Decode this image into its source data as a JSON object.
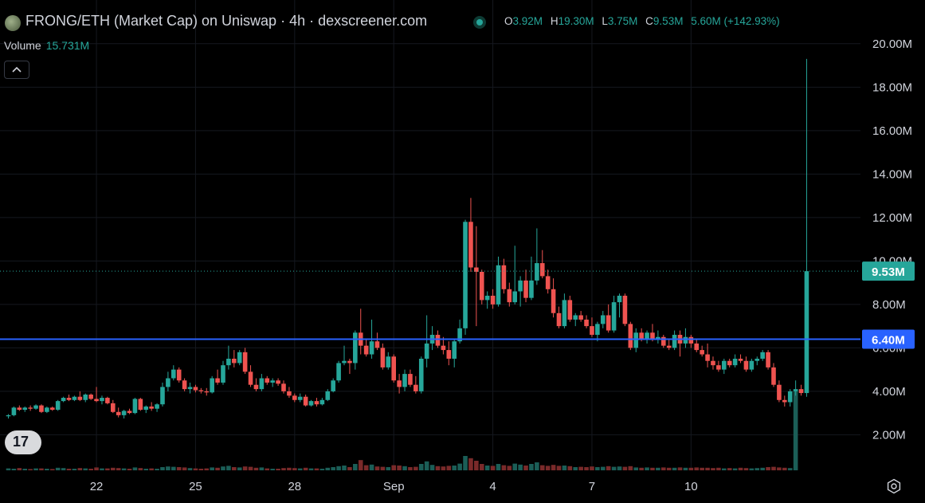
{
  "header": {
    "title": "FRONG/ETH (Market Cap) on Uniswap · 4h · dexscreener.com",
    "ohlc": [
      {
        "key": "O",
        "value": "3.92M"
      },
      {
        "key": "H",
        "value": "19.30M"
      },
      {
        "key": "L",
        "value": "3.75M"
      },
      {
        "key": "C",
        "value": "9.53M"
      },
      {
        "key": "",
        "value": "5.60M (+142.93%)"
      }
    ]
  },
  "volume_legend": {
    "label": "Volume",
    "value": "15.731M"
  },
  "colors": {
    "up": "#26a69a",
    "down": "#ef5350",
    "hline": "#2962ff",
    "background": "#000000",
    "text": "#d1d4dc"
  },
  "icons": {
    "collapse": "chevron-up-icon",
    "logo": "tradingview-logo-icon",
    "settings": "gear-icon"
  },
  "tv_logo_text": "17",
  "chart_data": {
    "type": "candlestick",
    "y_unit": "M",
    "ylim": [
      0.4,
      20.8
    ],
    "y_ticks": [
      "2.00M",
      "4.00M",
      "6.00M",
      "8.00M",
      "10.00M",
      "12.00M",
      "14.00M",
      "16.00M",
      "18.00M",
      "20.00M"
    ],
    "x_ticks": [
      "22",
      "25",
      "28",
      "Sep",
      "4",
      "7",
      "10"
    ],
    "grid": true,
    "last_price_label": "9.53M",
    "last_price": 9.53,
    "horizontal_line": {
      "value": 6.4,
      "label": "6.40M"
    },
    "ohlc": [
      [
        2.85,
        2.95,
        2.75,
        2.9
      ],
      [
        2.9,
        3.3,
        2.85,
        3.25
      ],
      [
        3.25,
        3.35,
        3.1,
        3.15
      ],
      [
        3.15,
        3.3,
        3.05,
        3.25
      ],
      [
        3.25,
        3.35,
        3.1,
        3.2
      ],
      [
        3.2,
        3.4,
        3.15,
        3.35
      ],
      [
        3.35,
        3.4,
        3.0,
        3.05
      ],
      [
        3.05,
        3.3,
        3.0,
        3.25
      ],
      [
        3.25,
        3.3,
        3.1,
        3.15
      ],
      [
        3.15,
        3.6,
        3.1,
        3.55
      ],
      [
        3.55,
        3.75,
        3.5,
        3.7
      ],
      [
        3.7,
        3.85,
        3.55,
        3.6
      ],
      [
        3.6,
        3.8,
        3.55,
        3.75
      ],
      [
        3.75,
        4.0,
        3.55,
        3.6
      ],
      [
        3.6,
        3.9,
        3.5,
        3.85
      ],
      [
        3.85,
        3.9,
        3.6,
        3.65
      ],
      [
        3.65,
        4.2,
        3.5,
        3.55
      ],
      [
        3.55,
        3.8,
        3.4,
        3.7
      ],
      [
        3.7,
        3.75,
        3.4,
        3.45
      ],
      [
        3.45,
        3.6,
        3.0,
        3.05
      ],
      [
        3.05,
        3.25,
        2.8,
        2.9
      ],
      [
        2.9,
        3.15,
        2.75,
        3.1
      ],
      [
        3.1,
        3.2,
        2.95,
        3.0
      ],
      [
        3.0,
        3.7,
        2.95,
        3.65
      ],
      [
        3.65,
        3.7,
        3.1,
        3.15
      ],
      [
        3.15,
        3.35,
        3.0,
        3.3
      ],
      [
        3.3,
        3.5,
        3.1,
        3.2
      ],
      [
        3.2,
        3.45,
        3.05,
        3.4
      ],
      [
        3.4,
        4.4,
        3.3,
        4.2
      ],
      [
        4.2,
        4.9,
        4.0,
        4.6
      ],
      [
        4.6,
        5.2,
        4.5,
        5.0
      ],
      [
        5.0,
        5.1,
        4.4,
        4.5
      ],
      [
        4.5,
        4.6,
        4.0,
        4.1
      ],
      [
        4.1,
        4.4,
        3.9,
        4.2
      ],
      [
        4.2,
        4.3,
        3.95,
        4.05
      ],
      [
        4.05,
        4.15,
        3.9,
        4.0
      ],
      [
        4.0,
        4.15,
        3.8,
        3.95
      ],
      [
        3.95,
        4.7,
        3.9,
        4.6
      ],
      [
        4.6,
        5.0,
        4.3,
        4.4
      ],
      [
        4.4,
        5.4,
        4.3,
        5.2
      ],
      [
        5.2,
        6.1,
        5.0,
        5.5
      ],
      [
        5.5,
        5.9,
        5.1,
        5.3
      ],
      [
        5.3,
        5.9,
        5.2,
        5.8
      ],
      [
        5.8,
        6.0,
        4.8,
        4.9
      ],
      [
        4.9,
        5.2,
        4.2,
        4.3
      ],
      [
        4.3,
        4.6,
        4.0,
        4.1
      ],
      [
        4.1,
        4.8,
        4.0,
        4.6
      ],
      [
        4.6,
        4.7,
        4.3,
        4.4
      ],
      [
        4.4,
        4.6,
        4.2,
        4.5
      ],
      [
        4.5,
        4.6,
        4.25,
        4.35
      ],
      [
        4.35,
        4.5,
        3.9,
        4.0
      ],
      [
        4.0,
        4.2,
        3.7,
        3.8
      ],
      [
        3.8,
        3.9,
        3.5,
        3.6
      ],
      [
        3.6,
        3.9,
        3.5,
        3.75
      ],
      [
        3.75,
        3.85,
        3.3,
        3.35
      ],
      [
        3.35,
        3.6,
        3.3,
        3.55
      ],
      [
        3.55,
        3.7,
        3.3,
        3.4
      ],
      [
        3.4,
        3.7,
        3.35,
        3.6
      ],
      [
        3.6,
        4.1,
        3.55,
        4.0
      ],
      [
        4.0,
        4.6,
        3.95,
        4.5
      ],
      [
        4.5,
        5.4,
        4.4,
        5.3
      ],
      [
        5.3,
        6.1,
        5.2,
        5.4
      ],
      [
        5.4,
        5.5,
        4.8,
        5.3
      ],
      [
        5.3,
        6.8,
        5.0,
        6.7
      ],
      [
        6.7,
        7.8,
        5.7,
        6.1
      ],
      [
        6.1,
        6.4,
        5.6,
        5.7
      ],
      [
        5.7,
        7.3,
        5.5,
        6.3
      ],
      [
        6.3,
        6.7,
        5.9,
        6.0
      ],
      [
        6.0,
        6.2,
        5.0,
        5.1
      ],
      [
        5.1,
        5.8,
        5.0,
        5.6
      ],
      [
        5.6,
        5.7,
        4.4,
        4.5
      ],
      [
        4.5,
        4.8,
        3.9,
        4.2
      ],
      [
        4.2,
        5.0,
        4.0,
        4.8
      ],
      [
        4.8,
        5.0,
        4.2,
        4.3
      ],
      [
        4.3,
        4.7,
        3.9,
        4.0
      ],
      [
        4.0,
        5.6,
        3.9,
        5.5
      ],
      [
        5.5,
        7.5,
        5.1,
        6.2
      ],
      [
        6.2,
        7.0,
        5.9,
        6.6
      ],
      [
        6.6,
        6.8,
        6.0,
        6.1
      ],
      [
        6.1,
        6.5,
        5.7,
        5.9
      ],
      [
        5.9,
        6.3,
        5.2,
        5.5
      ],
      [
        5.5,
        6.4,
        5.1,
        6.3
      ],
      [
        6.3,
        7.3,
        6.2,
        6.9
      ],
      [
        6.9,
        11.9,
        6.6,
        11.8
      ],
      [
        11.8,
        12.9,
        9.5,
        9.7
      ],
      [
        9.7,
        11.6,
        7.0,
        9.5
      ],
      [
        9.5,
        9.6,
        8.0,
        8.2
      ],
      [
        8.2,
        8.6,
        7.8,
        8.4
      ],
      [
        8.4,
        8.7,
        7.8,
        8.0
      ],
      [
        8.0,
        10.2,
        7.9,
        9.8
      ],
      [
        9.8,
        10.1,
        8.5,
        8.7
      ],
      [
        8.7,
        9.0,
        7.9,
        8.1
      ],
      [
        8.1,
        10.7,
        8.0,
        8.6
      ],
      [
        8.6,
        9.3,
        7.9,
        9.1
      ],
      [
        9.1,
        9.6,
        8.1,
        8.3
      ],
      [
        8.3,
        10.2,
        8.2,
        9.1
      ],
      [
        9.1,
        11.5,
        8.9,
        9.9
      ],
      [
        9.9,
        10.5,
        9.2,
        9.3
      ],
      [
        9.3,
        9.6,
        8.5,
        8.7
      ],
      [
        8.7,
        9.2,
        7.4,
        7.6
      ],
      [
        7.6,
        7.9,
        6.9,
        7.0
      ],
      [
        7.0,
        8.5,
        6.9,
        8.2
      ],
      [
        8.2,
        8.4,
        7.2,
        7.3
      ],
      [
        7.3,
        7.6,
        7.0,
        7.5
      ],
      [
        7.5,
        7.7,
        7.2,
        7.3
      ],
      [
        7.3,
        7.5,
        6.9,
        7.0
      ],
      [
        7.0,
        7.4,
        6.5,
        6.6
      ],
      [
        6.6,
        7.2,
        6.3,
        7.1
      ],
      [
        7.1,
        7.7,
        6.9,
        7.5
      ],
      [
        7.5,
        8.0,
        6.7,
        6.8
      ],
      [
        6.8,
        8.4,
        6.7,
        8.1
      ],
      [
        8.1,
        8.5,
        7.4,
        8.4
      ],
      [
        8.4,
        8.5,
        7.0,
        7.1
      ],
      [
        7.1,
        7.2,
        5.9,
        6.0
      ],
      [
        6.0,
        6.9,
        5.8,
        6.7
      ],
      [
        6.7,
        6.9,
        6.3,
        6.4
      ],
      [
        6.4,
        6.8,
        6.2,
        6.7
      ],
      [
        6.7,
        7.1,
        6.3,
        6.4
      ],
      [
        6.4,
        6.8,
        6.2,
        6.5
      ],
      [
        6.5,
        6.6,
        6.0,
        6.1
      ],
      [
        6.1,
        6.4,
        5.9,
        6.0
      ],
      [
        6.0,
        6.8,
        5.9,
        6.6
      ],
      [
        6.6,
        6.8,
        5.6,
        6.2
      ],
      [
        6.2,
        6.9,
        6.0,
        6.5
      ],
      [
        6.5,
        6.6,
        6.0,
        6.2
      ],
      [
        6.2,
        6.4,
        5.8,
        5.9
      ],
      [
        5.9,
        6.1,
        5.6,
        5.7
      ],
      [
        5.7,
        6.2,
        5.1,
        5.4
      ],
      [
        5.4,
        5.6,
        5.0,
        5.2
      ],
      [
        5.2,
        5.4,
        4.9,
        5.0
      ],
      [
        5.0,
        5.5,
        4.8,
        5.4
      ],
      [
        5.4,
        5.5,
        5.1,
        5.2
      ],
      [
        5.2,
        5.7,
        5.1,
        5.5
      ],
      [
        5.5,
        5.7,
        5.3,
        5.4
      ],
      [
        5.4,
        5.6,
        4.9,
        5.0
      ],
      [
        5.0,
        5.5,
        4.9,
        5.4
      ],
      [
        5.4,
        5.6,
        5.2,
        5.5
      ],
      [
        5.5,
        5.9,
        5.4,
        5.8
      ],
      [
        5.8,
        5.9,
        5.0,
        5.1
      ],
      [
        5.1,
        5.3,
        4.2,
        4.3
      ],
      [
        4.3,
        4.5,
        3.5,
        3.6
      ],
      [
        3.6,
        3.8,
        3.3,
        3.5
      ],
      [
        3.5,
        4.1,
        3.3,
        4.0
      ],
      [
        4.0,
        4.5,
        3.8,
        4.1
      ],
      [
        4.1,
        4.3,
        3.8,
        3.92
      ],
      [
        3.92,
        19.3,
        3.75,
        9.53
      ]
    ],
    "volume": [
      0.6,
      0.5,
      0.7,
      0.5,
      0.4,
      0.6,
      0.6,
      0.5,
      0.4,
      0.8,
      0.7,
      0.5,
      0.5,
      0.7,
      0.6,
      0.5,
      0.9,
      0.6,
      0.6,
      0.8,
      0.7,
      0.6,
      0.5,
      0.9,
      0.7,
      0.5,
      0.6,
      0.5,
      1.0,
      1.2,
      1.1,
      1.0,
      0.9,
      0.7,
      0.6,
      0.5,
      0.6,
      0.9,
      0.8,
      1.2,
      1.4,
      1.0,
      0.9,
      1.2,
      1.1,
      0.8,
      0.9,
      0.6,
      0.5,
      0.5,
      0.7,
      0.8,
      0.7,
      0.6,
      0.8,
      0.6,
      0.6,
      0.5,
      0.8,
      1.0,
      1.3,
      1.5,
      1.0,
      2.0,
      3.2,
      1.6,
      1.8,
      1.2,
      1.1,
      1.0,
      1.6,
      1.5,
      1.3,
      1.0,
      1.1,
      2.0,
      2.8,
      1.7,
      1.3,
      1.2,
      1.4,
      1.5,
      2.1,
      4.5,
      3.8,
      3.0,
      2.0,
      1.5,
      1.4,
      2.0,
      1.6,
      1.4,
      2.1,
      1.8,
      1.5,
      2.0,
      2.5,
      1.6,
      1.4,
      1.7,
      1.4,
      1.5,
      1.3,
      1.0,
      1.1,
      1.0,
      1.2,
      1.0,
      1.1,
      1.3,
      1.1,
      1.2,
      1.1,
      1.3,
      0.9,
      0.8,
      0.9,
      0.8,
      0.8,
      0.9,
      0.8,
      0.8,
      0.9,
      0.8,
      0.8,
      0.9,
      0.8,
      0.8,
      0.7,
      0.8,
      0.6,
      0.7,
      0.6,
      0.8,
      0.7,
      0.6,
      0.7,
      0.8,
      1.0,
      1.1,
      0.9,
      0.8,
      0.7,
      15.731
    ]
  }
}
